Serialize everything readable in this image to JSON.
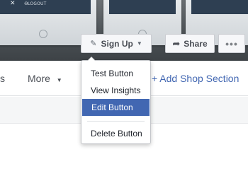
{
  "cover": {
    "phone_screen_close": "✕",
    "phone_screen_glyph": "⊖",
    "phone_screen_logout": "LOGOUT",
    "signup_label": "Sign Up",
    "share_label": "Share",
    "more_dots": "•••"
  },
  "nav": {
    "partial_tab": "s",
    "more_label": "More",
    "add_section_label": "+ Add Shop Section"
  },
  "dropdown": {
    "items": [
      {
        "label": "Test Button"
      },
      {
        "label": "View Insights"
      },
      {
        "label": "Edit Button"
      },
      {
        "label": "Delete Button"
      }
    ],
    "active_item": "Edit Button"
  },
  "colors": {
    "accent": "#4267b2",
    "text": "#1d2129",
    "muted": "#4b4f56"
  },
  "icons": {
    "signup": "pencil-icon",
    "share": "share-arrow-icon",
    "caret": "caret-down-icon"
  }
}
